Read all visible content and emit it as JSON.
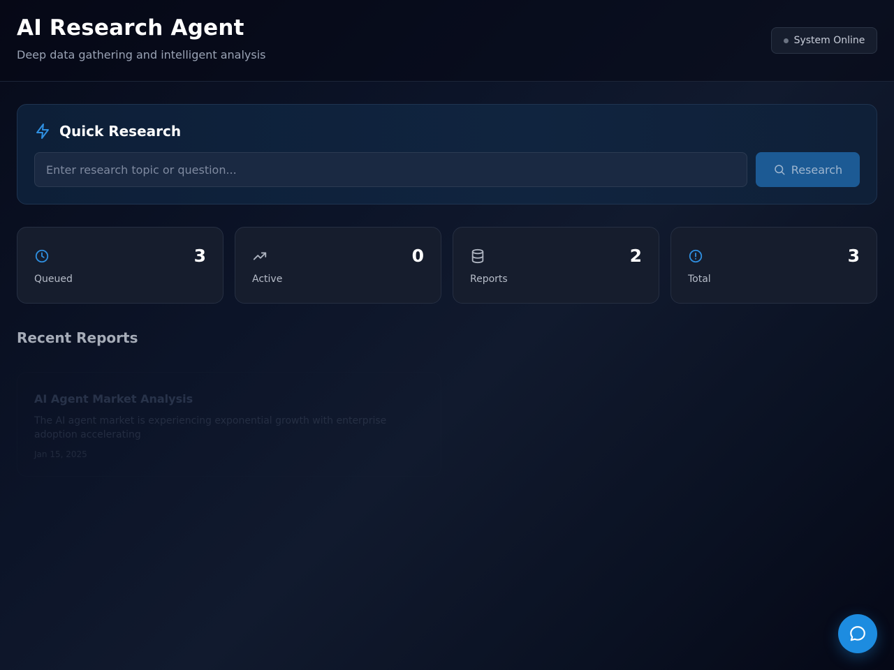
{
  "header": {
    "title": "AI Research Agent",
    "subtitle": "Deep data gathering and intelligent analysis",
    "status": "System Online"
  },
  "quick_research": {
    "title": "Quick Research",
    "input_value": "",
    "placeholder": "Enter research topic or question...",
    "button_label": "Research"
  },
  "stats": [
    {
      "label": "Queued",
      "value": "3",
      "icon": "clock-icon"
    },
    {
      "label": "Active",
      "value": "0",
      "icon": "trending-up-icon"
    },
    {
      "label": "Reports",
      "value": "2",
      "icon": "database-icon"
    },
    {
      "label": "Total",
      "value": "3",
      "icon": "alert-circle-icon"
    }
  ],
  "recent_reports": {
    "title": "Recent Reports",
    "items": [
      {
        "title": "AI Agent Market Analysis",
        "description": "The AI agent market is experiencing exponential growth with enterprise adoption accelerating",
        "date": "Jan 15, 2025"
      }
    ]
  },
  "colors": {
    "accent": "#1d8ce0",
    "icon_blue": "#2f8fe0",
    "icon_gray": "#aeb4c0"
  }
}
